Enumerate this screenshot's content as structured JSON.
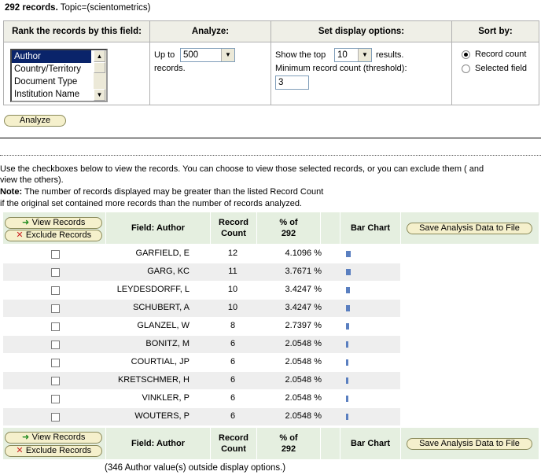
{
  "header": {
    "count": "292 records.",
    "topic": "Topic=(scientometrics)"
  },
  "options": {
    "rank_header": "Rank the records by this field:",
    "analyze_header": "Analyze:",
    "display_header": "Set display options:",
    "sort_header": "Sort by:",
    "rank_fields": [
      "Author",
      "Country/Territory",
      "Document Type",
      "Institution Name"
    ],
    "analyze_prefix": "Up to",
    "analyze_value": "500",
    "analyze_suffix": "records.",
    "show_prefix": "Show the top",
    "show_value": "10",
    "show_suffix": "results.",
    "threshold_label": "Minimum record count (threshold):",
    "threshold_value": "3",
    "sort_record_count": "Record count",
    "sort_selected_field": "Selected field"
  },
  "analyze_button": "Analyze",
  "instructions": {
    "line1": "Use the checkboxes below to view the records. You can choose to view those selected records, or you can exclude them ( and",
    "line2": "view the others).",
    "note_label": "Note:",
    "note_text": " The number of records displayed may be greater than the listed Record Count",
    "line4": "if the original set contained more records than the number of records analyzed."
  },
  "results_header": {
    "view_records": "View Records",
    "exclude_records": "Exclude Records",
    "field": "Field: Author",
    "record_count_1": "Record",
    "record_count_2": "Count",
    "pct_1": "% of",
    "pct_2": "292",
    "bar_chart": "Bar Chart",
    "save": "Save Analysis Data to File"
  },
  "rows": [
    {
      "name": "GARFIELD, E",
      "count": "12",
      "pct": "4.1096 %",
      "bar": 12
    },
    {
      "name": "GARG, KC",
      "count": "11",
      "pct": "3.7671 %",
      "bar": 11
    },
    {
      "name": "LEYDESDORFF, L",
      "count": "10",
      "pct": "3.4247 %",
      "bar": 10
    },
    {
      "name": "SCHUBERT, A",
      "count": "10",
      "pct": "3.4247 %",
      "bar": 10
    },
    {
      "name": "GLANZEL, W",
      "count": "8",
      "pct": "2.7397 %",
      "bar": 8
    },
    {
      "name": "BONITZ, M",
      "count": "6",
      "pct": "2.0548 %",
      "bar": 6
    },
    {
      "name": "COURTIAL, JP",
      "count": "6",
      "pct": "2.0548 %",
      "bar": 6
    },
    {
      "name": "KRETSCHMER, H",
      "count": "6",
      "pct": "2.0548 %",
      "bar": 6
    },
    {
      "name": "VINKLER, P",
      "count": "6",
      "pct": "2.0548 %",
      "bar": 6
    },
    {
      "name": "WOUTERS, P",
      "count": "6",
      "pct": "2.0548 %",
      "bar": 6
    }
  ],
  "footer_note": "(346 Author value(s) outside display options.)",
  "colors": {
    "header_bg": "#e5efe0",
    "button_bg": "#f5f0cc",
    "bar": "#5a7fc0",
    "selected": "#0a246a"
  }
}
